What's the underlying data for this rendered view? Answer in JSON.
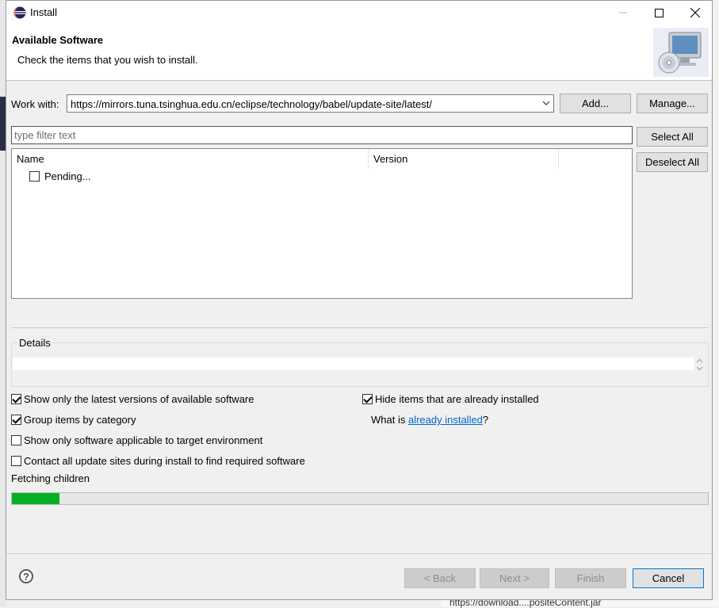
{
  "window": {
    "title": "Install"
  },
  "header": {
    "title": "Available Software",
    "description": "Check the items that you wish to install."
  },
  "work_with": {
    "label": "Work with:",
    "value": "https://mirrors.tuna.tsinghua.edu.cn/eclipse/technology/babel/update-site/latest/",
    "add_label": "Add...",
    "manage_label": "Manage..."
  },
  "filter": {
    "placeholder": "type filter text"
  },
  "side_buttons": {
    "select_all": "Select All",
    "deselect_all": "Deselect All"
  },
  "tree": {
    "columns": [
      "Name",
      "Version"
    ],
    "rows": [
      {
        "label": "Pending...",
        "checked": false
      }
    ]
  },
  "details": {
    "label": "Details",
    "text": ""
  },
  "options": {
    "latest_versions": {
      "label": "Show only the latest versions of available software",
      "checked": true
    },
    "group_by_category": {
      "label": "Group items by category",
      "checked": true
    },
    "target_env": {
      "label": "Show only software applicable to target environment",
      "checked": false
    },
    "contact_sites": {
      "label": "Contact all update sites during install to find required software",
      "checked": false
    },
    "hide_installed": {
      "label": "Hide items that are already installed",
      "checked": true
    },
    "what_is_prefix": "What is ",
    "already_installed_link": "already installed",
    "what_is_suffix": "?"
  },
  "status": {
    "text": "Fetching children",
    "progress": 0.068,
    "progress_color": "#06b025"
  },
  "footer": {
    "back": "< Back",
    "next": "Next >",
    "finish": "Finish",
    "cancel": "Cancel"
  },
  "background": {
    "bottom_text": "https://download....positeContent.jar"
  }
}
